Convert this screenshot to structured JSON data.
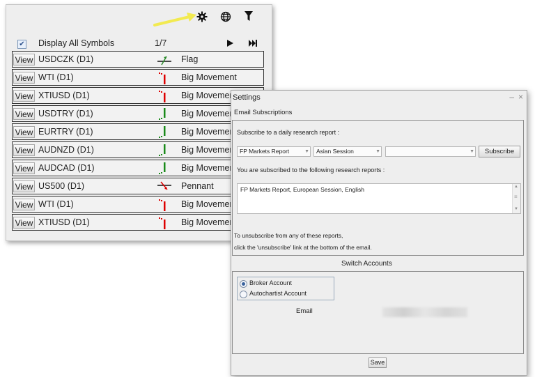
{
  "toolbar": {
    "icons": [
      "gear-icon",
      "globe-icon",
      "filter-icon"
    ],
    "highlight_color": "#f2ea50"
  },
  "display": {
    "label": "Display All Symbols",
    "checked": true,
    "page": "1/7"
  },
  "rows": [
    {
      "view": "View",
      "symbol": "USDCZK (D1)",
      "pattern": "Flag",
      "icon": "flag-icon"
    },
    {
      "view": "View",
      "symbol": "WTI (D1)",
      "pattern": "Big Movement",
      "icon": "big-movement-down-icon"
    },
    {
      "view": "View",
      "symbol": "XTIUSD (D1)",
      "pattern": "Big Movemen",
      "icon": "big-movement-down-icon"
    },
    {
      "view": "View",
      "symbol": "USDTRY (D1)",
      "pattern": "Big Movemen",
      "icon": "big-movement-up-icon"
    },
    {
      "view": "View",
      "symbol": "EURTRY (D1)",
      "pattern": "Big Movemen",
      "icon": "big-movement-up-icon"
    },
    {
      "view": "View",
      "symbol": "AUDNZD (D1)",
      "pattern": "Big Movemen",
      "icon": "big-movement-up-icon"
    },
    {
      "view": "View",
      "symbol": "AUDCAD (D1)",
      "pattern": "Big Movemen",
      "icon": "big-movement-up-icon"
    },
    {
      "view": "View",
      "symbol": "US500 (D1)",
      "pattern": "Pennant",
      "icon": "pennant-icon"
    },
    {
      "view": "View",
      "symbol": "WTI (D1)",
      "pattern": "Big Movemen",
      "icon": "big-movement-down-icon"
    },
    {
      "view": "View",
      "symbol": "XTIUSD (D1)",
      "pattern": "Big Movemen",
      "icon": "big-movement-down-icon"
    }
  ],
  "settings": {
    "title": "Settings",
    "minimize": "–",
    "close": "×",
    "email_section": "Email Subscriptions",
    "subscribe_prompt": "Subscribe to a daily research report :",
    "report_select": "FP Markets Report",
    "session_select": "Asian Session",
    "language_select": "",
    "subscribe_button": "Subscribe",
    "subscribed_label": "You are subscribed to the following research reports :",
    "subscribed_reports": "FP Markets Report, European Session, English",
    "unsubscribe_line1": "To unsubscribe from any of these reports,",
    "unsubscribe_line2": "click the 'unsubscribe' link at the bottom of the email.",
    "switch_accounts": "Switch Accounts",
    "broker_account": "Broker Account",
    "autochartist_account": "Autochartist Account",
    "selected_account": "Broker Account",
    "email_label": "Email",
    "save_button": "Save"
  }
}
